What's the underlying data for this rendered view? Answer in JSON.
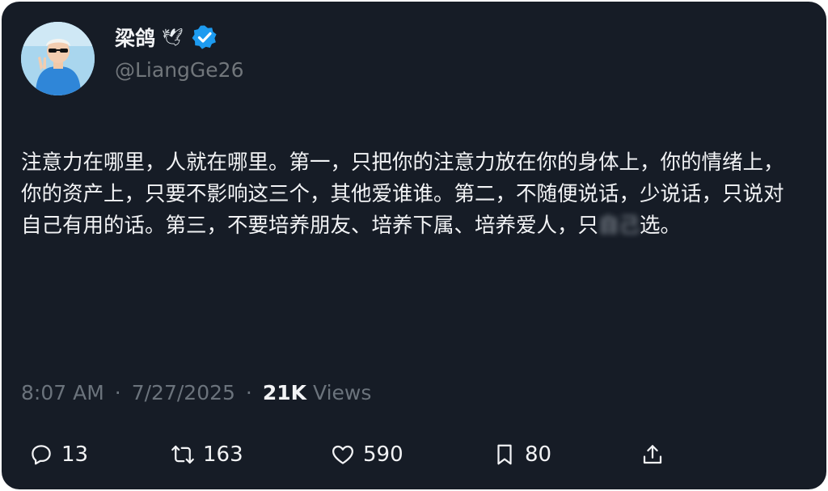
{
  "author": {
    "display_name": "梁鸽",
    "dove_glyph": "🕊",
    "handle": "@LiangGe26",
    "verified": true
  },
  "tweet": {
    "text_main": "注意力在哪里，人就在哪里。第一，只把你的注意力放在你的身体上，你的情绪上，你的资产上，只要不影响这三个，其他爱谁谁。第二，不随便说话，少说话，只说对自己有用的话。第三，不要培养朋友、培养下属、培养爱人，只",
    "text_blurred": "自己",
    "text_end": "选。"
  },
  "meta": {
    "time": "8:07 AM",
    "separator": "·",
    "date": "7/27/2025",
    "views_count": "21K",
    "views_label": "Views"
  },
  "actions": {
    "replies": "13",
    "retweets": "163",
    "likes": "590",
    "bookmarks": "80"
  },
  "colors": {
    "background": "#161c26",
    "text": "#f2f3f5",
    "muted": "#71767b",
    "verified": "#1d9bf0"
  }
}
